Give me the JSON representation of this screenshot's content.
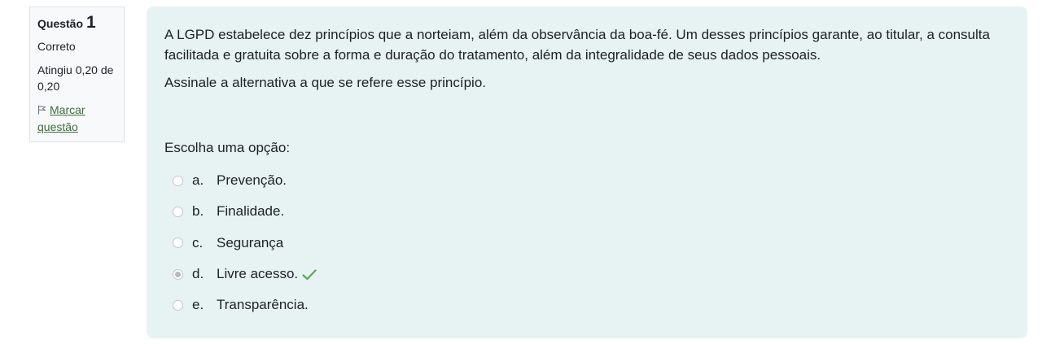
{
  "info": {
    "question_label": "Questão",
    "question_number": "1",
    "state": "Correto",
    "grade": "Atingiu 0,20 de 0,20",
    "flag_text": "Marcar questão"
  },
  "question": {
    "paragraph1": "A LGPD estabelece dez princípios que a norteiam, além da observância da boa-fé. Um desses princípios garante, ao titular, a consulta facilitada e gratuita sobre a forma e duração do tratamento, além da integralidade de seus dados pessoais.",
    "paragraph2": "Assinale a alternativa a que se refere esse princípio.",
    "prompt": "Escolha uma opção:",
    "options": [
      {
        "letter": "a.",
        "text": "Prevenção.",
        "selected": false
      },
      {
        "letter": "b.",
        "text": "Finalidade.",
        "selected": false
      },
      {
        "letter": "c.",
        "text": "Segurança",
        "selected": false
      },
      {
        "letter": "d.",
        "text": "Livre acesso.",
        "selected": true,
        "correct": true
      },
      {
        "letter": "e.",
        "text": "Transparência.",
        "selected": false
      }
    ]
  },
  "colors": {
    "content_bg": "#e7f2f3",
    "correct_check": "#5fa55a",
    "link": "#3b6e3a"
  },
  "icons": {
    "flag": "flag-icon",
    "correct": "check-icon"
  }
}
